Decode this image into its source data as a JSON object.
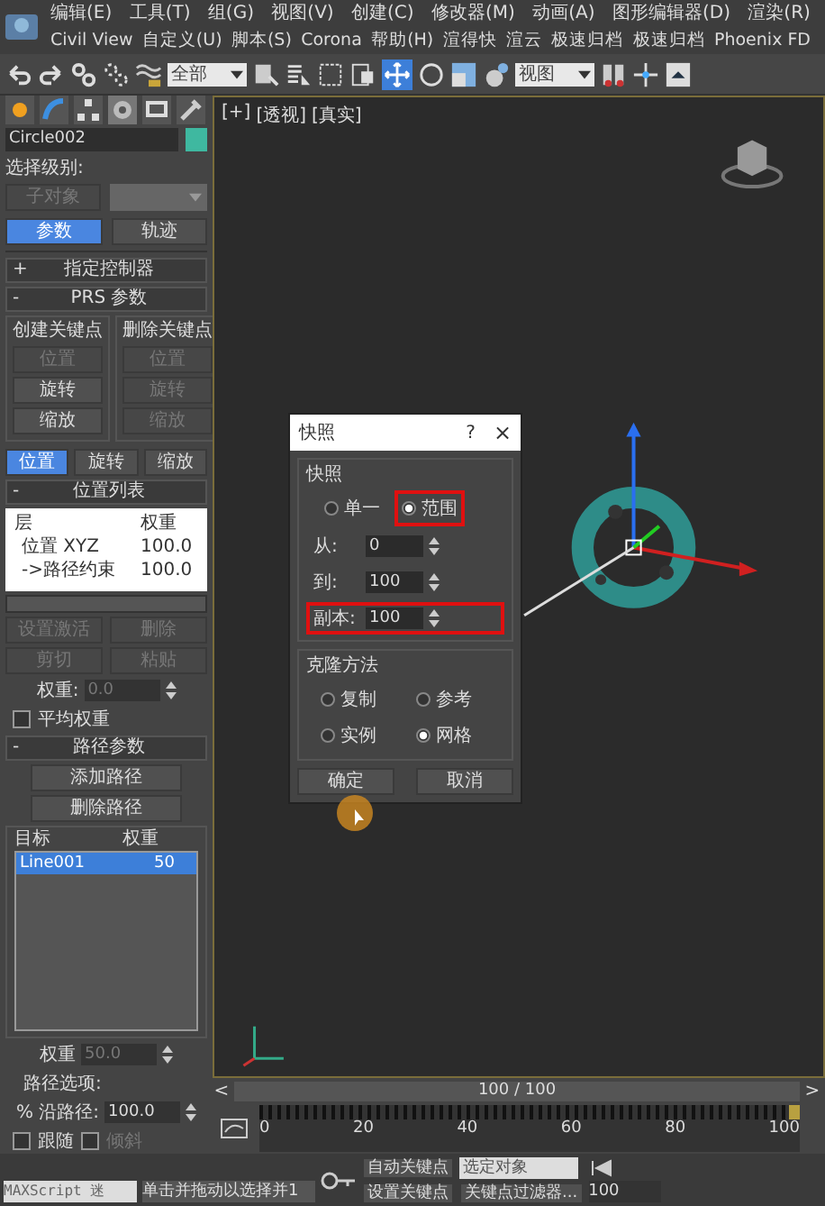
{
  "menu_rows": [
    [
      "编辑(E)",
      "工具(T)",
      "组(G)",
      "视图(V)",
      "创建(C)",
      "修改器(M)",
      "动画(A)",
      "图形编辑器(D)",
      "渲染(R)"
    ],
    [
      "Civil View",
      "自定义(U)",
      "脚本(S)",
      "Corona",
      "帮助(H)",
      "渲得快",
      "渲云",
      "极速归档",
      "极速归档",
      "Phoenix FD"
    ]
  ],
  "toolbar": {
    "selection_filter": "全部",
    "coordinate_system": "视图"
  },
  "command_panel": {
    "object_name": "Circle002",
    "selection_level": {
      "label": "选择级别:",
      "button": "子对象",
      "button_disabled": true
    },
    "modes": [
      {
        "label": "参数",
        "selected": true
      },
      {
        "label": "轨迹",
        "selected": false
      }
    ],
    "assign_controller": {
      "sign": "+",
      "title": "指定控制器"
    },
    "prs": {
      "sign": "-",
      "title": "PRS 参数",
      "groups": [
        {
          "title": "创建关键点",
          "buttons": [
            {
              "label": "位置",
              "disabled": true
            },
            {
              "label": "旋转",
              "disabled": false
            },
            {
              "label": "缩放",
              "disabled": false
            }
          ]
        },
        {
          "title": "删除关键点",
          "buttons": [
            {
              "label": "位置",
              "disabled": true
            },
            {
              "label": "旋转",
              "disabled": true
            },
            {
              "label": "缩放",
              "disabled": true
            }
          ]
        }
      ],
      "tabs": [
        {
          "label": "位置",
          "selected": true
        },
        {
          "label": "旋转",
          "selected": false
        },
        {
          "label": "缩放",
          "selected": false
        }
      ]
    },
    "position_list": {
      "sign": "-",
      "title": "位置列表",
      "columns": [
        "层",
        "权重"
      ],
      "rows": [
        {
          "name": "位置 XYZ",
          "weight": "100.0"
        },
        {
          "name": "->路径约束",
          "weight": "100.0"
        }
      ],
      "buttons": [
        {
          "label": "设置激活",
          "disabled": true
        },
        {
          "label": "删除",
          "disabled": true
        },
        {
          "label": "剪切",
          "disabled": true
        },
        {
          "label": "粘贴",
          "disabled": true
        }
      ],
      "weight_label": "权重:",
      "weight_value": "0.0",
      "weight_disabled": true,
      "average": {
        "label": "平均权重",
        "checked": false
      }
    },
    "path_params": {
      "sign": "-",
      "title": "路径参数",
      "buttons": [
        "添加路径",
        "删除路径"
      ],
      "columns": [
        "目标",
        "权重"
      ],
      "rows": [
        {
          "name": "Line001",
          "weight": "50",
          "selected": true
        }
      ],
      "weight_label": "权重",
      "weight_value": "50.0",
      "options_label": "路径选项:",
      "along_label": "% 沿路径:",
      "along_value": "100.0",
      "checks": [
        {
          "label": "跟随",
          "checked": false,
          "disabled": false
        },
        {
          "label": "倾斜",
          "checked": false,
          "disabled": true
        }
      ]
    }
  },
  "viewport": {
    "labels": [
      "[+]",
      "[透视]",
      "[真实]"
    ]
  },
  "dialog": {
    "title": "快照",
    "help": "?",
    "close": "×",
    "snapshot": {
      "title": "快照",
      "options": [
        {
          "label": "单一",
          "selected": false,
          "highlighted": false
        },
        {
          "label": "范围",
          "selected": true,
          "highlighted": true
        }
      ],
      "fields": [
        {
          "label": "从:",
          "value": "0",
          "highlighted": false
        },
        {
          "label": "到:",
          "value": "100",
          "highlighted": false
        },
        {
          "label": "副本:",
          "value": "100",
          "highlighted": true
        }
      ]
    },
    "clone": {
      "title": "克隆方法",
      "options": [
        {
          "label": "复制",
          "selected": false
        },
        {
          "label": "参考",
          "selected": false
        },
        {
          "label": "实例",
          "selected": false
        },
        {
          "label": "网格",
          "selected": true
        }
      ]
    },
    "buttons": [
      "确定",
      "取消"
    ]
  },
  "timeline": {
    "slider": {
      "prev": "<",
      "frame": "100 / 100",
      "next": ">",
      "level": 1.0
    },
    "ruler": {
      "ticks": [
        "0",
        "20",
        "40",
        "60",
        "80",
        "100"
      ],
      "level": 1.0
    }
  },
  "bottom": {
    "maxscript": "MAXScript 迷",
    "status": "单击并拖动以选择并1",
    "auto_key": "自动关键点",
    "selected_set": "选定对象",
    "set_key": "设置关键点",
    "key_filters": "关键点过滤器...",
    "current_frame": "100"
  }
}
